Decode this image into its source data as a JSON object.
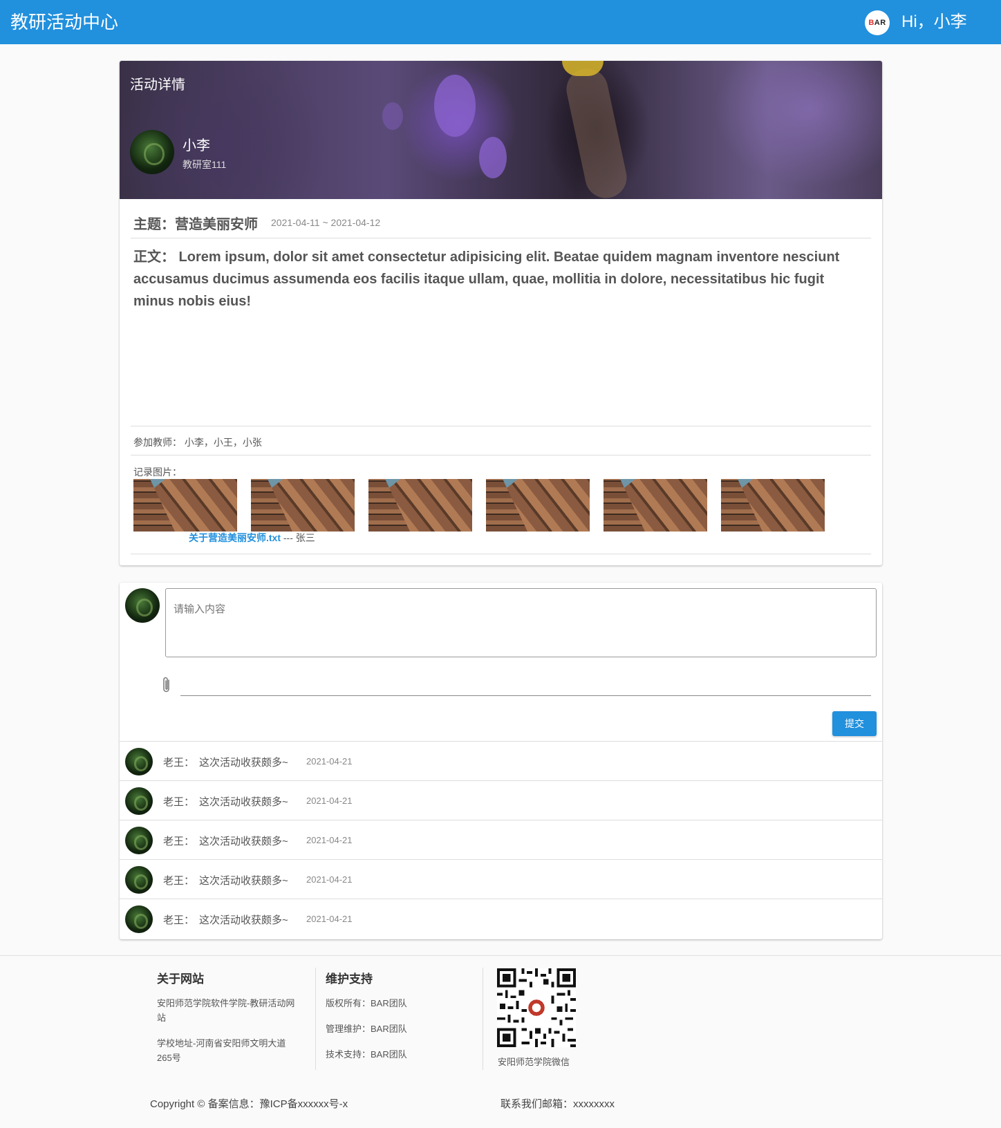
{
  "header": {
    "title": "教研活动中心",
    "logo_text": "BAR",
    "greeting": "Hi，小李"
  },
  "activity": {
    "banner_title": "活动详情",
    "user_name": "小李",
    "user_room": "教研室111",
    "subject": "主题：营造美丽安师",
    "date_range": "2021-04-11 ~ 2021-04-12",
    "body": "正文：  Lorem ipsum, dolor sit amet consectetur adipisicing elit. Beatae quidem magnam inventore nesciunt accusamus ducimus assumenda eos facilis itaque ullam, quae, mollitia in dolore, necessitatibus hic fugit minus nobis eius!",
    "teachers": "参加教师：  小李，小王，小张",
    "photos_label": "记录图片：",
    "photo_count": 6,
    "attachment_name": "关于营造美丽安师.txt",
    "attachment_by": " --- 张三"
  },
  "comment_form": {
    "placeholder": "请输入内容",
    "submit_label": "提交"
  },
  "comments": [
    {
      "author": "老王：",
      "text": "这次活动收获颇多~",
      "date": "2021-04-21"
    },
    {
      "author": "老王：",
      "text": "这次活动收获颇多~",
      "date": "2021-04-21"
    },
    {
      "author": "老王：",
      "text": "这次活动收获颇多~",
      "date": "2021-04-21"
    },
    {
      "author": "老王：",
      "text": "这次活动收获颇多~",
      "date": "2021-04-21"
    },
    {
      "author": "老王：",
      "text": "这次活动收获颇多~",
      "date": "2021-04-21"
    }
  ],
  "footer": {
    "about_title": "关于网站",
    "about_line1": "安阳师范学院软件学院-教研活动网站",
    "about_line2": "学校地址-河南省安阳师文明大道265号",
    "support_title": "维护支持",
    "copyright_owner": "版权所有：BAR团队",
    "maintainer": "管理维护：BAR团队",
    "tech_support": "技术支持：BAR团队",
    "qr_caption": "安阳师范学院微信",
    "copyright": "Copyright © 备案信息：豫ICP备xxxxxx号-x",
    "contact": "联系我们邮箱：xxxxxxxx"
  },
  "colors": {
    "primary": "#2190dd",
    "background": "#fafafa"
  }
}
